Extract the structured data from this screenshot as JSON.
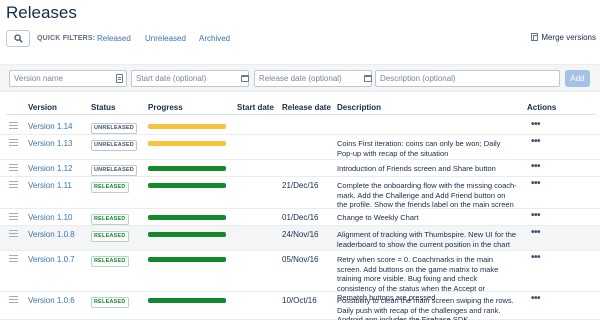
{
  "page": {
    "title": "Releases"
  },
  "filters": {
    "label": "QUICK FILTERS:",
    "items": [
      "Released",
      "Unreleased",
      "Archived"
    ],
    "merge": "Merge versions"
  },
  "form": {
    "version_placeholder": "Version name",
    "start_placeholder": "Start date (optional)",
    "release_placeholder": "Release date (optional)",
    "desc_placeholder": "Description (optional)",
    "add_label": "Add"
  },
  "columns": {
    "version": "Version",
    "status": "Status",
    "progress": "Progress",
    "start": "Start date",
    "release": "Release date",
    "description": "Description",
    "actions": "Actions"
  },
  "colors": {
    "link": "#3b73af",
    "released": "#14892c",
    "in_progress": "#f6c342",
    "done": "#14892c",
    "add_button": "#a3c2e6"
  },
  "rows": [
    {
      "version": "Version 1.14",
      "status": "UNRELEASED",
      "status_type": "unreleased",
      "progress_color": "#f6c342",
      "progress": 1.0,
      "start": "",
      "release": "",
      "description": "",
      "actions": "•••"
    },
    {
      "version": "Version 1.13",
      "status": "UNRELEASED",
      "status_type": "unreleased",
      "progress_color": "#f6c342",
      "progress": 1.0,
      "start": "",
      "release": "",
      "description": "Coins First iteration: coins can only be won; Daily Pop-up with recap of the situation",
      "actions": "•••"
    },
    {
      "version": "Version 1.12",
      "status": "UNRELEASED",
      "status_type": "unreleased",
      "progress_color": "#14892c",
      "progress": 1.0,
      "start": "",
      "release": "",
      "description": "Introduction of Friends screen and Share button",
      "actions": "•••"
    },
    {
      "version": "Version 1.11",
      "status": "RELEASED",
      "status_type": "released",
      "progress_color": "#14892c",
      "progress": 1.0,
      "start": "",
      "release": "21/Dec/16",
      "description": "Complete the onboarding flow with the missing coach-mark. Add the Challenge and Add Friend button on the profile. Show the friends label on the main screen",
      "actions": "•••"
    },
    {
      "version": "Version 1.10",
      "status": "RELEASED",
      "status_type": "released",
      "progress_color": "#14892c",
      "progress": 1.0,
      "start": "",
      "release": "01/Dec/16",
      "description": "Change to Weekly Chart",
      "actions": "•••"
    },
    {
      "version": "Version 1.0.8",
      "status": "RELEASED",
      "status_type": "released",
      "progress_color": "#14892c",
      "progress": 1.0,
      "start": "",
      "release": "24/Nov/16",
      "description": "Alignment of tracking with Thumbspire. New UI for the leaderboard to show the current position in the chart",
      "actions": "•••"
    },
    {
      "version": "Version 1.0.7",
      "status": "RELEASED",
      "status_type": "released",
      "progress_color": "#14892c",
      "progress": 1.0,
      "start": "",
      "release": "05/Nov/16",
      "description": "Retry when score = 0. Coachmarks in the main screen. Add buttons on the game matrix to make training more visible. Bug fixing and check consistency of the status when the Accept or Rematch buttons are pressed",
      "actions": "•••"
    },
    {
      "version": "Version 1.0.6",
      "status": "RELEASED",
      "status_type": "released",
      "progress_color": "#14892c",
      "progress": 1.0,
      "start": "",
      "release": "10/Oct/16",
      "description": "Possibility to clean the main screen swiping the rows. Daily push with recap of the challenges and rank. Android app includes the Firebase SDK",
      "actions": "•••"
    }
  ]
}
